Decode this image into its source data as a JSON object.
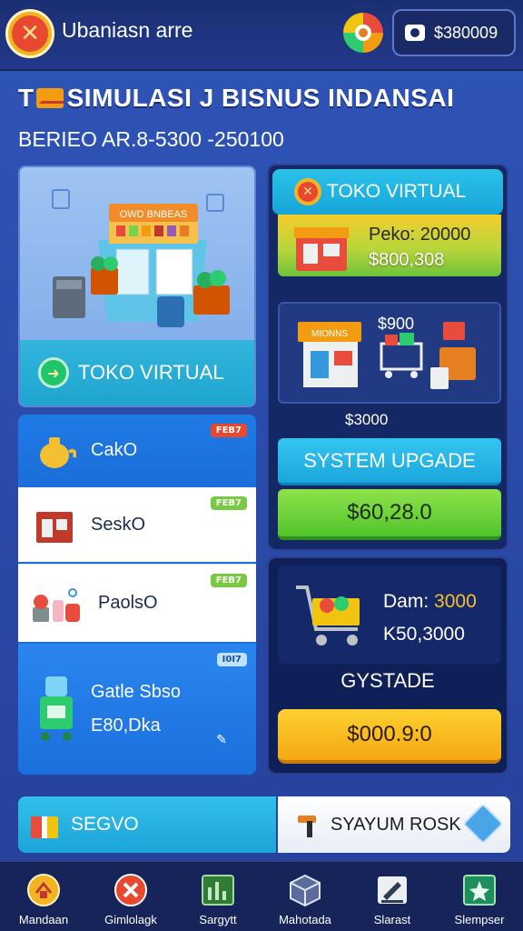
{
  "header": {
    "app_title": "Ubaniasn arre",
    "balance": "$380009"
  },
  "hero": {
    "title_prefix": "T",
    "title": "SIMULASI J BISNUS INDANSAI",
    "subtitle": "BERIEO AR.8-5300 -250100"
  },
  "store_card": {
    "sign_text": "OWD BNBEAS",
    "button_label": "TOKO VIRTUAL"
  },
  "list": [
    {
      "label": "CakO",
      "tag": "FEB7"
    },
    {
      "label": "SeskO",
      "tag": "FEB7"
    },
    {
      "label": "PaolsO",
      "tag": "FEB7"
    },
    {
      "label": "Gatle Sbso",
      "sub": "E80,Dka",
      "tag": "I0I7"
    }
  ],
  "right_panel": {
    "header_label": "TOKO VIRTUAL",
    "price_line_1": "Peko: 20000",
    "price_line_2": "$800,308",
    "shop_sign": "MIONNS",
    "goods_price": "$900",
    "small_price": "$3000",
    "upgrade_button": "SYSTEM UPGADE",
    "green_button": "$60,28.0"
  },
  "cart_panel": {
    "line_1_label": "Dam:",
    "line_1_value": "3000",
    "line_2": "K50,3000",
    "label": "GYSTADE",
    "button": "$000.9:0"
  },
  "bottom_strip": {
    "left_label": "SEGVO",
    "right_label": "SYAYUM ROSK"
  },
  "nav": [
    {
      "label": "Mandaan",
      "icon": "home-badge-icon"
    },
    {
      "label": "Gimlolagk",
      "icon": "close-circle-icon"
    },
    {
      "label": "Sargytt",
      "icon": "chart-board-icon"
    },
    {
      "label": "Mahotada",
      "icon": "cube-icon"
    },
    {
      "label": "Slarast",
      "icon": "edit-pen-icon"
    },
    {
      "label": "Slempser",
      "icon": "star-card-icon"
    }
  ]
}
